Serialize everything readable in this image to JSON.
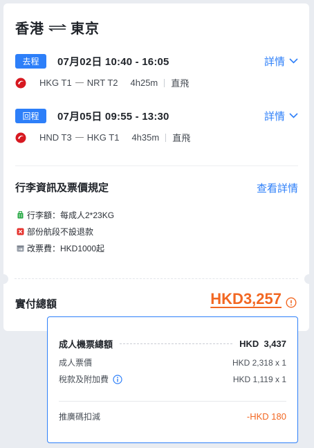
{
  "route": {
    "origin": "香港",
    "destination": "東京"
  },
  "segments": [
    {
      "badge": "去程",
      "datetime": "07月02日  10:40 - 16:05",
      "details_label": "詳情",
      "from": "HKG T1",
      "to": "NRT T2",
      "duration": "4h25m",
      "type": "直飛"
    },
    {
      "badge": "回程",
      "datetime": "07月05日  09:55 - 13:30",
      "details_label": "詳情",
      "from": "HND T3",
      "to": "HKG T1",
      "duration": "4h35m",
      "type": "直飛"
    }
  ],
  "baggage": {
    "title": "行李資訊及票價規定",
    "view_details": "查看詳情",
    "rules": [
      "行李額：每成人2*23KG",
      "部份航段不設退款",
      "改票費：HKD1000起"
    ]
  },
  "total": {
    "label": "實付總額",
    "amount": "HKD3,257"
  },
  "breakdown": {
    "adult_total_label": "成人機票總額",
    "adult_total_value": "HKD  3,437",
    "adult_fare_label": "成人票價",
    "adult_fare_value": "HKD 2,318 x 1",
    "tax_label": "稅款及附加費",
    "tax_value": "HKD 1,119 x 1",
    "promo_label": "推廣碼扣減",
    "promo_value": "-HKD 180"
  },
  "colors": {
    "accent": "#2d7ff9",
    "price": "#f26722",
    "airline": "#d71921"
  }
}
